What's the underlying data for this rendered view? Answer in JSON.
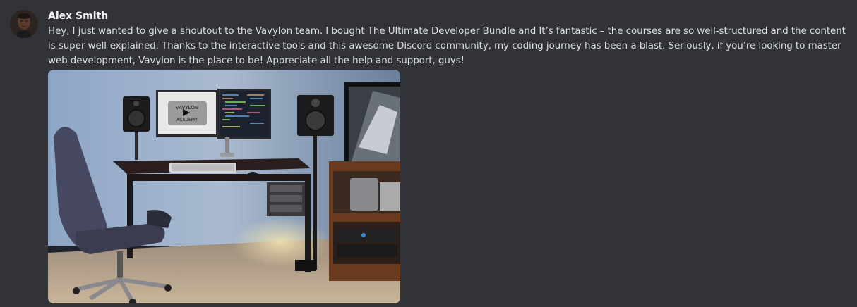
{
  "message": {
    "author": "Alex Smith",
    "text": "Hey, I just wanted to give a shoutout to the Vavylon team. I bought The Ultimate Developer Bundle and It’s fantastic – the courses are so well-structured and the content is super well-explained. Thanks to the interactive tools and this awesome Discord community, my coding journey has been a blast. Seriously, if you’re looking to master web development, Vavylon is the place to be! Appreciate all the help and support, guys!",
    "avatar_icon": "user-avatar-icon"
  },
  "attachment": {
    "monitor_logo_line1": "VAVYLON",
    "monitor_logo_line2": "ACADEMY",
    "play_icon": "play-icon"
  },
  "colors": {
    "background": "#313338",
    "author": "#f2f3f5",
    "text": "#dbdee1"
  }
}
